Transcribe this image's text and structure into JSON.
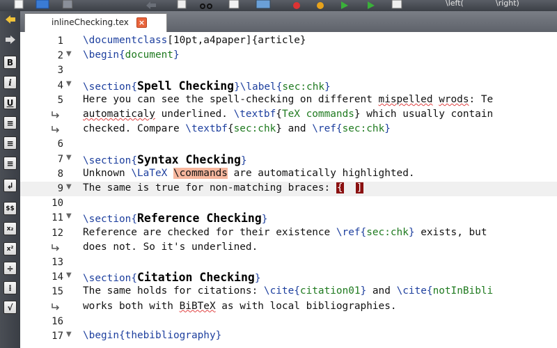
{
  "tab": {
    "filename": "inlineChecking.tex",
    "close_glyph": "×"
  },
  "toolbar": {
    "items": [
      "new-file",
      "save",
      "copy",
      "cut",
      "paste",
      "image",
      "undo",
      "redo",
      "compile",
      "zoom"
    ],
    "right_text": [
      "\\left(",
      "\\right)"
    ]
  },
  "sidebar": {
    "buttons": [
      {
        "name": "arrow-left-icon",
        "glyph": ""
      },
      {
        "name": "arrow-right-icon",
        "glyph": ""
      },
      {
        "name": "bold-icon",
        "glyph": "B"
      },
      {
        "name": "italic-icon",
        "glyph": "i"
      },
      {
        "name": "underline-icon",
        "glyph": "U"
      },
      {
        "name": "align-left-icon",
        "glyph": "≡"
      },
      {
        "name": "align-center-icon",
        "glyph": "≡"
      },
      {
        "name": "align-right-icon",
        "glyph": "≡"
      },
      {
        "name": "newline-icon",
        "glyph": "↲"
      },
      {
        "name": "math-dollar-icon",
        "glyph": "$$"
      },
      {
        "name": "subscript-icon",
        "glyph": "x₂"
      },
      {
        "name": "superscript-icon",
        "glyph": "x²"
      },
      {
        "name": "fraction-icon",
        "glyph": "÷"
      },
      {
        "name": "dfrac-icon",
        "glyph": "⁞"
      },
      {
        "name": "sqrt-icon",
        "glyph": "√"
      }
    ]
  },
  "editor": {
    "current_line": 9,
    "lines": [
      {
        "n": "1",
        "fold": false,
        "wrap": false,
        "segs": [
          [
            "cmd",
            "\\documentclass"
          ],
          [
            "",
            "[10pt,a4paper]{article}"
          ]
        ]
      },
      {
        "n": "2",
        "fold": true,
        "wrap": false,
        "segs": [
          [
            "cmd",
            "\\begin"
          ],
          [
            "cmd",
            "{"
          ],
          [
            "arg",
            "document"
          ],
          [
            "cmd",
            "}"
          ]
        ]
      },
      {
        "n": "3",
        "fold": false,
        "wrap": false,
        "segs": []
      },
      {
        "n": "4",
        "fold": true,
        "wrap": false,
        "segs": [
          [
            "cmd",
            "\\section"
          ],
          [
            "cmd",
            "{"
          ],
          [
            "sec",
            "Spell Checking"
          ],
          [
            "cmd",
            "}"
          ],
          [
            "cmd",
            "\\label"
          ],
          [
            "cmd",
            "{"
          ],
          [
            "arg",
            "sec:chk"
          ],
          [
            "cmd",
            "}"
          ]
        ]
      },
      {
        "n": "5",
        "fold": false,
        "wrap": false,
        "segs": [
          [
            "",
            "Here you can see the spell-checking on different "
          ],
          [
            "sp",
            "mispelled"
          ],
          [
            "",
            " "
          ],
          [
            "sp",
            "wrods"
          ],
          [
            "",
            ": Te"
          ]
        ]
      },
      {
        "n": "",
        "fold": false,
        "wrap": true,
        "segs": [
          [
            "sp",
            "automaticaly"
          ],
          [
            "",
            " underlined. "
          ],
          [
            "cmd",
            "\\textbf"
          ],
          [
            "",
            "{"
          ],
          [
            "bold",
            "TeX commands"
          ],
          [
            "",
            "} which usually contain"
          ]
        ]
      },
      {
        "n": "",
        "fold": false,
        "wrap": true,
        "segs": [
          [
            "",
            "checked. Compare "
          ],
          [
            "cmd",
            "\\textbf"
          ],
          [
            "",
            "{"
          ],
          [
            "bold",
            "sec:chk"
          ],
          [
            "",
            "} and "
          ],
          [
            "cmd",
            "\\ref"
          ],
          [
            "cmd",
            "{"
          ],
          [
            "arg",
            "sec:chk"
          ],
          [
            "cmd",
            "}"
          ]
        ]
      },
      {
        "n": "6",
        "fold": false,
        "wrap": false,
        "segs": []
      },
      {
        "n": "7",
        "fold": true,
        "wrap": false,
        "segs": [
          [
            "cmd",
            "\\section"
          ],
          [
            "cmd",
            "{"
          ],
          [
            "sec",
            "Syntax Checking"
          ],
          [
            "cmd",
            "}"
          ]
        ]
      },
      {
        "n": "8",
        "fold": false,
        "wrap": false,
        "segs": [
          [
            "",
            "Unknown "
          ],
          [
            "cmd",
            "\\LaTeX"
          ],
          [
            "",
            " "
          ],
          [
            "err",
            "\\commands"
          ],
          [
            "",
            " are automatically highlighted."
          ]
        ]
      },
      {
        "n": "9",
        "fold": true,
        "wrap": false,
        "segs": [
          [
            "",
            "The same is true for non-matching braces: "
          ],
          [
            "brace",
            "{"
          ],
          [
            "",
            "  "
          ],
          [
            "brace",
            "]"
          ]
        ]
      },
      {
        "n": "10",
        "fold": false,
        "wrap": false,
        "segs": []
      },
      {
        "n": "11",
        "fold": true,
        "wrap": false,
        "segs": [
          [
            "cmd",
            "\\section"
          ],
          [
            "cmd",
            "{"
          ],
          [
            "sec",
            "Reference Checking"
          ],
          [
            "cmd",
            "}"
          ]
        ]
      },
      {
        "n": "12",
        "fold": false,
        "wrap": false,
        "segs": [
          [
            "",
            "Reference are checked for their existence "
          ],
          [
            "cmd",
            "\\ref"
          ],
          [
            "cmd",
            "{"
          ],
          [
            "arg",
            "sec:chk"
          ],
          [
            "cmd",
            "}"
          ],
          [
            "",
            " exists, but"
          ]
        ]
      },
      {
        "n": "",
        "fold": false,
        "wrap": true,
        "segs": [
          [
            "",
            "does not. So it's underlined."
          ]
        ]
      },
      {
        "n": "13",
        "fold": false,
        "wrap": false,
        "segs": []
      },
      {
        "n": "14",
        "fold": true,
        "wrap": false,
        "segs": [
          [
            "cmd",
            "\\section"
          ],
          [
            "cmd",
            "{"
          ],
          [
            "sec",
            "Citation Checking"
          ],
          [
            "cmd",
            "}"
          ]
        ]
      },
      {
        "n": "15",
        "fold": false,
        "wrap": false,
        "segs": [
          [
            "",
            "The same holds for citations: "
          ],
          [
            "cmd",
            "\\cite"
          ],
          [
            "cmd",
            "{"
          ],
          [
            "arg",
            "citation01"
          ],
          [
            "cmd",
            "}"
          ],
          [
            "",
            " and "
          ],
          [
            "cmd",
            "\\cite"
          ],
          [
            "cmd",
            "{"
          ],
          [
            "arg",
            "notInBibli"
          ]
        ]
      },
      {
        "n": "",
        "fold": false,
        "wrap": true,
        "segs": [
          [
            "",
            "works both with "
          ],
          [
            "sp",
            "BiBTeX"
          ],
          [
            "",
            " as with local bibliographies."
          ]
        ]
      },
      {
        "n": "16",
        "fold": false,
        "wrap": false,
        "segs": []
      },
      {
        "n": "17",
        "fold": true,
        "wrap": false,
        "segs": [
          [
            "cmd",
            "\\begin"
          ],
          [
            "cmd",
            "{"
          ],
          [
            "cmd",
            "thebibliography"
          ],
          [
            "cmd",
            "}"
          ]
        ]
      }
    ]
  }
}
